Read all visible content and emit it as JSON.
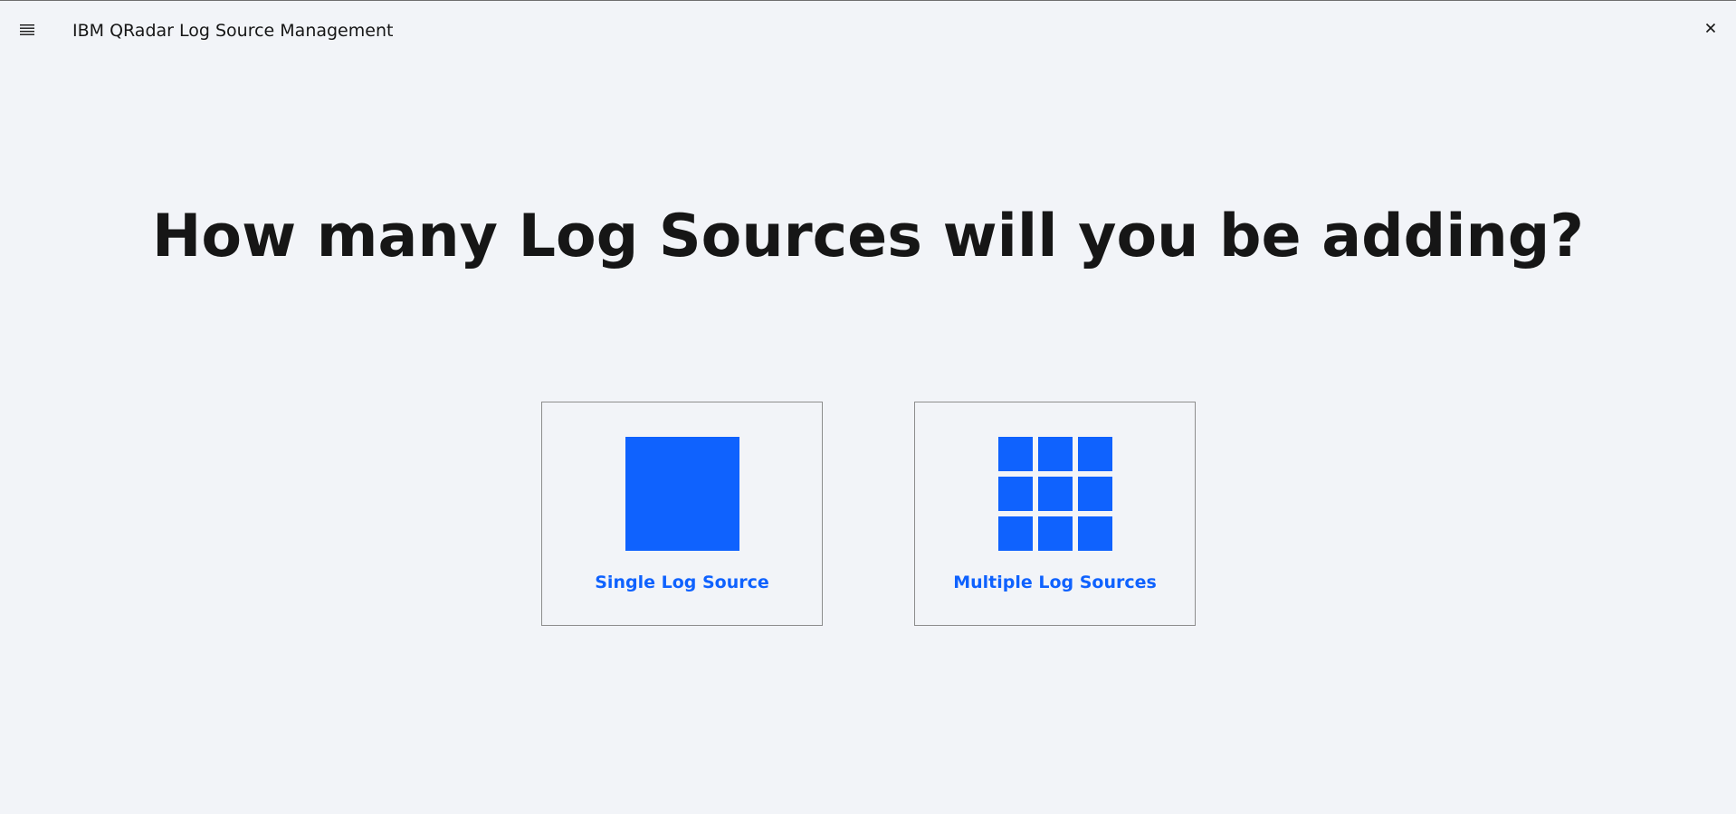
{
  "header": {
    "title": "IBM QRadar Log Source Management",
    "menu_icon": "hamburger-menu-icon",
    "close_icon": "close-icon"
  },
  "main": {
    "heading": "How many Log Sources will you be adding?",
    "options": [
      {
        "label": "Single Log Source",
        "icon": "single-square-icon"
      },
      {
        "label": "Multiple Log Sources",
        "icon": "grid-squares-icon"
      }
    ]
  },
  "colors": {
    "accent": "#0f62fe",
    "background": "#f2f4f8",
    "text": "#161616",
    "tile_border": "#8d8d8d"
  }
}
